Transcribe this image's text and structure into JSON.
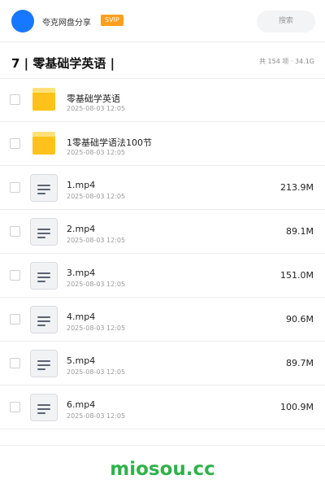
{
  "header": {
    "user_name": "夸克网盘分享",
    "badge": "SVIP",
    "search_placeholder": "搜索"
  },
  "folder": {
    "title": "7 | 零基础学英语 |",
    "meta": "共 154 项 · 34.1G"
  },
  "items": [
    {
      "type": "folder",
      "name": "零基础学英语",
      "date": "2025-08-03 12:05",
      "size": ""
    },
    {
      "type": "folder",
      "name": "1零基础学语法100节",
      "date": "2025-08-03 12:05",
      "size": ""
    },
    {
      "type": "file",
      "name": "1.mp4",
      "date": "2025-08-03 12:05",
      "size": "213.9M"
    },
    {
      "type": "file",
      "name": "2.mp4",
      "date": "2025-08-03 12:05",
      "size": "89.1M"
    },
    {
      "type": "file",
      "name": "3.mp4",
      "date": "2025-08-03 12:05",
      "size": "151.0M"
    },
    {
      "type": "file",
      "name": "4.mp4",
      "date": "2025-08-03 12:05",
      "size": "90.6M"
    },
    {
      "type": "file",
      "name": "5.mp4",
      "date": "2025-08-03 12:05",
      "size": "89.7M"
    },
    {
      "type": "file",
      "name": "6.mp4",
      "date": "2025-08-03 12:05",
      "size": "100.9M"
    }
  ],
  "watermark": "miosou.cc",
  "colors": {
    "avatar": "#1677ff",
    "badge": "#ff9f1c",
    "folder": "#ffc21a",
    "watermark": "#2fb24a"
  },
  "icons": {
    "folder": "folder-icon",
    "file": "video-file-icon"
  }
}
